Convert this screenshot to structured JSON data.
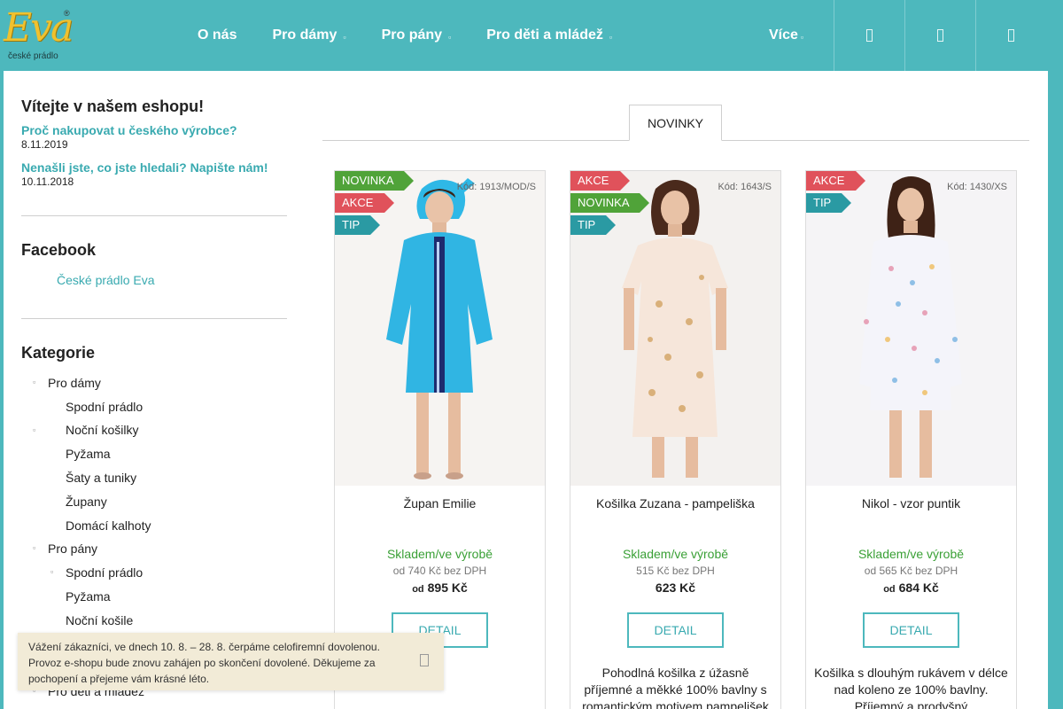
{
  "brand": {
    "name": "Eva",
    "registered": "®",
    "tagline": "české prádlo"
  },
  "nav": {
    "items": [
      {
        "label": "O nás",
        "has_caret": false
      },
      {
        "label": "Pro dámy",
        "has_caret": true
      },
      {
        "label": "Pro pány",
        "has_caret": true
      },
      {
        "label": "Pro děti a mládež",
        "has_caret": true
      }
    ],
    "more": {
      "label": "Více",
      "has_caret": true
    },
    "icons": [
      "search-icon",
      "user-icon",
      "cart-icon"
    ]
  },
  "sidebar": {
    "welcome_title": "Vítejte v našem eshopu!",
    "news": [
      {
        "title": "Proč nakupovat u českého výrobce?",
        "date": "8.11.2019"
      },
      {
        "title": "Nenašli jste, co jste hledali? Napište nám!",
        "date": "10.11.2018"
      }
    ],
    "facebook_title": "Facebook",
    "facebook_link": "České prádlo Eva",
    "categories_title": "Kategorie",
    "categories": [
      {
        "label": "Pro dámy",
        "level": 1,
        "bullet": true
      },
      {
        "label": "Spodní prádlo",
        "level": 2,
        "bullet": false
      },
      {
        "label": "Noční košilky",
        "level": 2,
        "bullet": true
      },
      {
        "label": "Pyžama",
        "level": 2,
        "bullet": false
      },
      {
        "label": "Šaty a tuniky",
        "level": 2,
        "bullet": false
      },
      {
        "label": "Župany",
        "level": 2,
        "bullet": false
      },
      {
        "label": "Domácí kalhoty",
        "level": 2,
        "bullet": false
      },
      {
        "label": "Pro pány",
        "level": 1,
        "bullet": true
      },
      {
        "label": "Spodní prádlo",
        "level": 2,
        "bullet": true
      },
      {
        "label": "Pyžama",
        "level": 2,
        "bullet": false
      },
      {
        "label": "Noční košile",
        "level": 2,
        "bullet": false
      },
      {
        "label": "Pro děti a mládež",
        "level": 1,
        "bullet": true
      }
    ]
  },
  "tabs": {
    "active": "NOVINKY"
  },
  "products": [
    {
      "name": "Župan Emilie",
      "code": "Kód: 1913/MOD/S",
      "flags": [
        "NOVINKA",
        "AKCE",
        "TIP"
      ],
      "flag_types": [
        "new",
        "sale",
        "tip"
      ],
      "stock": "Skladem/ve výrobě",
      "price_net": "od 740 Kč bez DPH",
      "price_prefix": "od",
      "price": "895 Kč",
      "detail_label": "DETAIL",
      "description": "",
      "garment_color": "#2fb8e6"
    },
    {
      "name": "Košilka Zuzana - pampeliška",
      "code": "Kód: 1643/S",
      "flags": [
        "AKCE",
        "NOVINKA",
        "TIP"
      ],
      "flag_types": [
        "sale",
        "new",
        "tip"
      ],
      "stock": "Skladem/ve výrobě",
      "price_net": "515 Kč bez DPH",
      "price_prefix": "",
      "price": "623 Kč",
      "detail_label": "DETAIL",
      "description": "Pohodlná košilka z úžasně příjemné a měkké 100% bavlny s romantickým motivem pampelišek",
      "garment_color": "#f6e6da"
    },
    {
      "name": "Nikol - vzor puntik",
      "code": "Kód: 1430/XS",
      "flags": [
        "AKCE",
        "TIP"
      ],
      "flag_types": [
        "sale",
        "tip"
      ],
      "stock": "Skladem/ve výrobě",
      "price_net": "od 565 Kč bez DPH",
      "price_prefix": "od",
      "price": "684 Kč",
      "detail_label": "DETAIL",
      "description": "Košilka s  dlouhým rukávem v délce nad koleno ze 100% bavlny. Příjemný a prodyšný",
      "garment_color": "#f4f4fa"
    }
  ],
  "notice": {
    "text": "Vážení zákazníci, ve dnech 10. 8. – 28. 8. čerpáme celofiremní dovolenou. Provoz e-shopu bude znovu zahájen po skončení dovolené. Děkujeme za pochopení a přejeme vám krásné léto."
  },
  "colors": {
    "header": "#4db8bd",
    "accent": "#39aab0",
    "stock_green": "#3aa036",
    "flag_new": "#50a339",
    "flag_sale": "#e0525b",
    "flag_tip": "#2a9aa3"
  }
}
